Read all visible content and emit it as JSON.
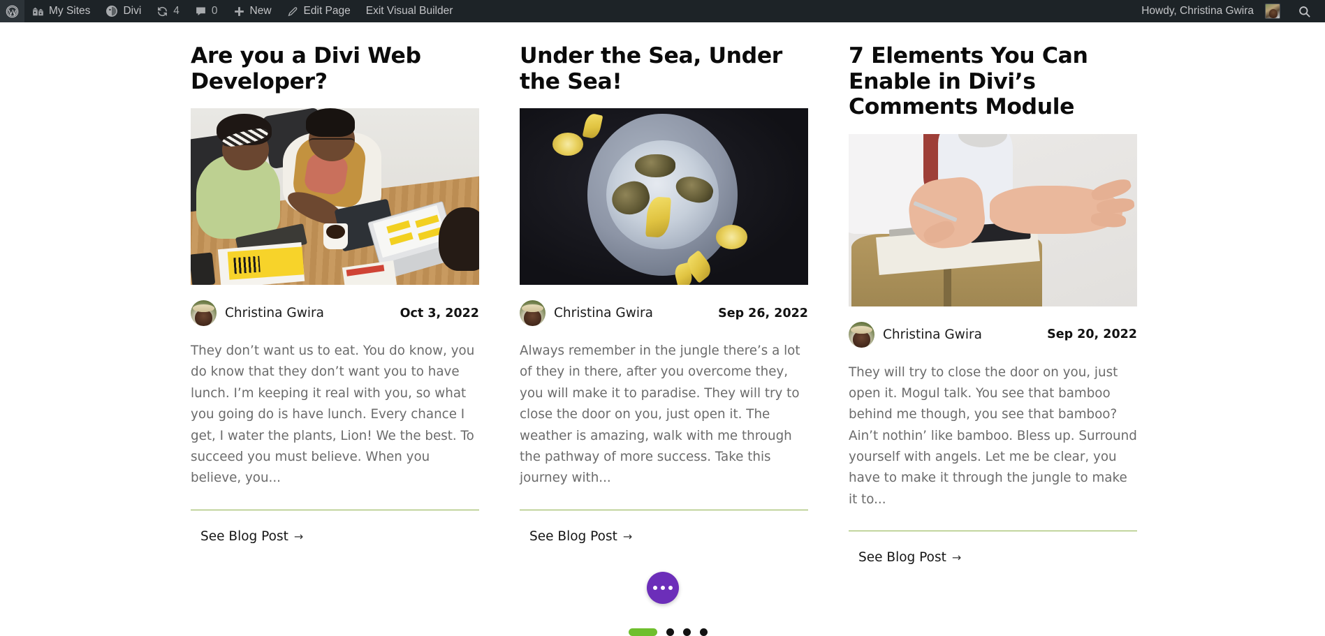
{
  "adminbar": {
    "left_items": [
      {
        "icon": "wordpress-logo-icon",
        "label": ""
      },
      {
        "icon": "my-sites-icon",
        "label": "My Sites"
      },
      {
        "icon": "divi-icon",
        "label": "Divi"
      },
      {
        "icon": "updates-icon",
        "label": "4"
      },
      {
        "icon": "comments-icon",
        "label": "0"
      },
      {
        "icon": "plus-icon",
        "label": "New"
      },
      {
        "icon": "pencil-icon",
        "label": "Edit Page"
      },
      {
        "icon": "",
        "label": "Exit Visual Builder"
      }
    ],
    "howdy": "Howdy, Christina Gwira",
    "avatar_name": "user-avatar",
    "search_icon": "search-icon"
  },
  "posts": [
    {
      "title": "Are you a Divi Web Developer?",
      "image_alt": "two colleagues reviewing documents at a wooden desk",
      "author": "Christina Gwira",
      "date": "Oct 3, 2022",
      "excerpt": "They don’t want us to eat. You do know, you do know that they don’t want you to have lunch. I’m keeping it real with you, so what you going do is have lunch. Every chance I get, I water the plants, Lion! We the best. To succeed you must believe. When you believe, you...",
      "read_more": "See Blog Post",
      "arrow": "→"
    },
    {
      "title": "Under the Sea, Under the Sea!",
      "image_alt": "oysters on crushed ice on a grey plate with lemon wedges",
      "author": "Christina Gwira",
      "date": "Sep 26, 2022",
      "excerpt": "Always remember in the jungle there’s a lot of they in there, after you overcome they, you will make it to paradise. They will try to close the door on you, just open it. The weather is amazing, walk with me through the pathway of more success. Take this journey with...",
      "read_more": "See Blog Post",
      "arrow": "→"
    },
    {
      "title": "7 Elements You Can Enable in Divi’s Comments Module",
      "image_alt": "seated person gesturing with open hands holding a clipboard",
      "author": "Christina Gwira",
      "date": "Sep 20, 2022",
      "excerpt": "They will try to close the door on you, just open it. Mogul talk. You see that bamboo behind me though, you see that bamboo? Ain’t nothin’ like bamboo. Bless up. Surround yourself with angels. Let me be clear, you have to make it through the jungle to make it to...",
      "read_more": "See Blog Post",
      "arrow": "→"
    }
  ],
  "builder": {
    "fab_name": "divi-menu-fab",
    "pagination": [
      {
        "type": "pill",
        "active": true
      },
      {
        "type": "dot",
        "active": false
      },
      {
        "type": "dot",
        "active": false
      },
      {
        "type": "dot",
        "active": false
      }
    ]
  },
  "colors": {
    "adminbar_bg": "#1d2327",
    "accent_green": "#6fbf2e",
    "divider_green": "#8db14b",
    "fab_purple": "#6c2eb9",
    "title_text": "#0b0b0b",
    "body_text": "#6b6b6b"
  }
}
